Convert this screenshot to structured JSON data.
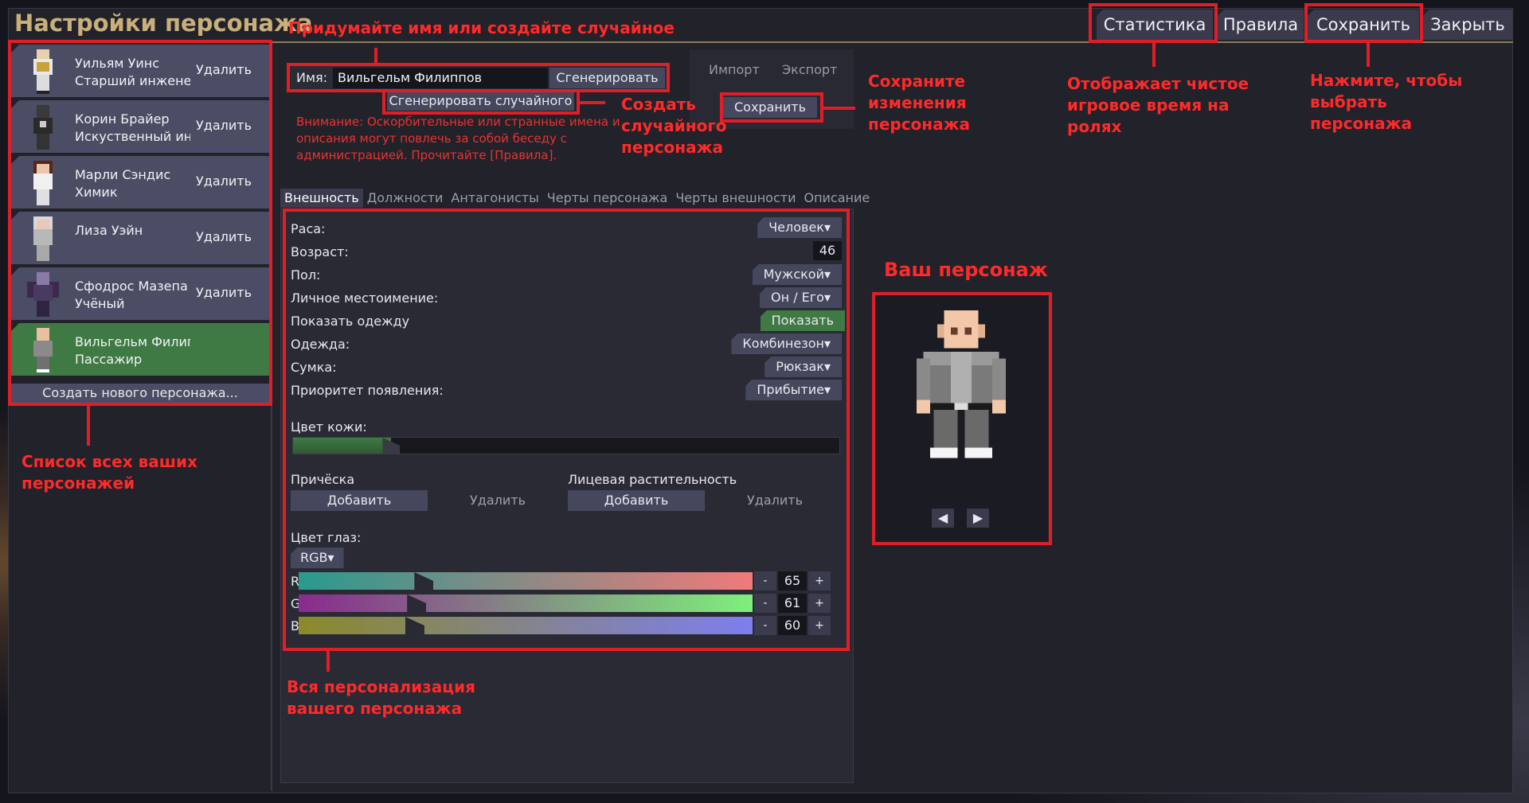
{
  "window": {
    "title": "Настройки персонажа"
  },
  "top_buttons": {
    "stats": "Статистика",
    "rules": "Правила",
    "save": "Сохранить",
    "close": "Закрыть"
  },
  "characters": [
    {
      "name": "Уильям Уинс",
      "role": "Старший инжене",
      "delete": "Удалить"
    },
    {
      "name": "Корин Брайер",
      "role": "Искуственный ин",
      "delete": "Удалить"
    },
    {
      "name": "Марли Сэндис",
      "role": "Химик",
      "delete": "Удалить"
    },
    {
      "name": "Лиза Уэйн",
      "role": "",
      "delete": "Удалить"
    },
    {
      "name": "Сфодрос Мазепа",
      "role": "Учёный",
      "delete": "Удалить"
    },
    {
      "name": "Вильгельм Филиппов",
      "role": "Пассажир",
      "delete": ""
    }
  ],
  "create_new": "Создать нового персонажа...",
  "name_section": {
    "label": "Имя:",
    "value": "Вильгельм Филиппов",
    "generate": "Сгенерировать",
    "generate_random": "Сгенерировать случайного",
    "warning": "Внимание: Оскорбительные или странные имена и описания могут повлечь за собой беседу с администрацией. Прочитайте [Правила]."
  },
  "import_export": {
    "import": "Импорт",
    "export": "Экспорт",
    "save": "Сохранить"
  },
  "tabs": [
    "Внешность",
    "Должности",
    "Антагонисты",
    "Черты персонажа",
    "Черты внешности",
    "Описание"
  ],
  "appearance": {
    "race_label": "Раса:",
    "race_value": "Человек▾",
    "age_label": "Возраст:",
    "age_value": "46",
    "sex_label": "Пол:",
    "sex_value": "Мужской▾",
    "pronoun_label": "Личное местоимение:",
    "pronoun_value": "Он / Его▾",
    "show_clothes_label": "Показать одежду",
    "show_clothes_value": "Показать",
    "clothes_label": "Одежда:",
    "clothes_value": "Комбинезон▾",
    "bag_label": "Сумка:",
    "bag_value": "Рюкзак▾",
    "spawn_label": "Приоритет появления:",
    "spawn_value": "Прибытие▾",
    "skin_label": "Цвет кожи:",
    "skin_level": 0.18,
    "hair_label": "Причёска",
    "facial_hair_label": "Лицевая растительность",
    "add": "Добавить",
    "remove": "Удалить",
    "eye_label": "Цвет глаз:",
    "eye_mode": "RGB▾",
    "rgb": [
      {
        "channel": "R",
        "value": "65",
        "minus": "-",
        "plus": "+",
        "level": 0.255
      },
      {
        "channel": "G",
        "value": "61",
        "minus": "-",
        "plus": "+",
        "level": 0.239
      },
      {
        "channel": "B",
        "value": "60",
        "minus": "-",
        "plus": "+",
        "level": 0.235
      }
    ]
  },
  "preview": {
    "left_arrow": "◀",
    "right_arrow": "▶"
  },
  "annotations": {
    "name_hint": "Придумайте имя или создайте случайное",
    "random_hint": "Создать случайного персонажа",
    "save_hint": "Сохраните изменения персонажа",
    "stats_hint": "Отображает чистое игровое время на ролях",
    "select_hint": "Нажмите, чтобы выбрать персонажа",
    "your_char": "Ваш персонаж",
    "list_hint": "Список всех ваших персонажей",
    "custom_hint": "Вся персонализация вашего персонажа"
  },
  "colors": {
    "accent_red": "#e01e28",
    "title_gold": "#c9b07a",
    "button": "#45475d",
    "active_green": "#3f7a44"
  }
}
